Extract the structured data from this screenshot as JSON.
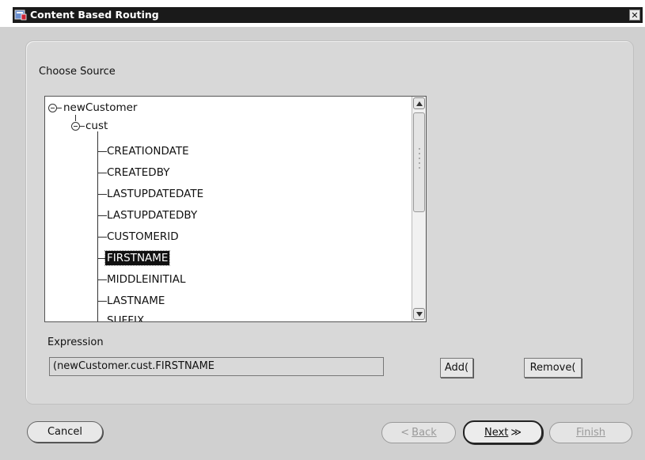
{
  "window": {
    "title": "Content Based Routing",
    "close_glyph": "✕"
  },
  "source": {
    "label": "Choose Source"
  },
  "tree": {
    "root": "newCustomer",
    "child": "cust",
    "fields": [
      "CREATIONDATE",
      "CREATEDBY",
      "LASTUPDATEDATE",
      "LASTUPDATEDBY",
      "CUSTOMERID",
      "FIRSTNAME",
      "MIDDLEINITIAL",
      "LASTNAME",
      "SUFFIX"
    ],
    "selected": "FIRSTNAME"
  },
  "expression": {
    "label": "Expression",
    "value": "(newCustomer.cust.FIRSTNAME"
  },
  "buttons": {
    "add": "Add(",
    "remove": "Remove(",
    "cancel": "Cancel",
    "back": "Back",
    "back_glyph": "<",
    "next": "Next",
    "next_glyph": "≫",
    "finish": "Finish"
  },
  "icons": {
    "window": "window-icon",
    "collapse": "minus-circle-icon",
    "scroll_up": "arrow-up-icon",
    "scroll_down": "arrow-down-icon"
  }
}
